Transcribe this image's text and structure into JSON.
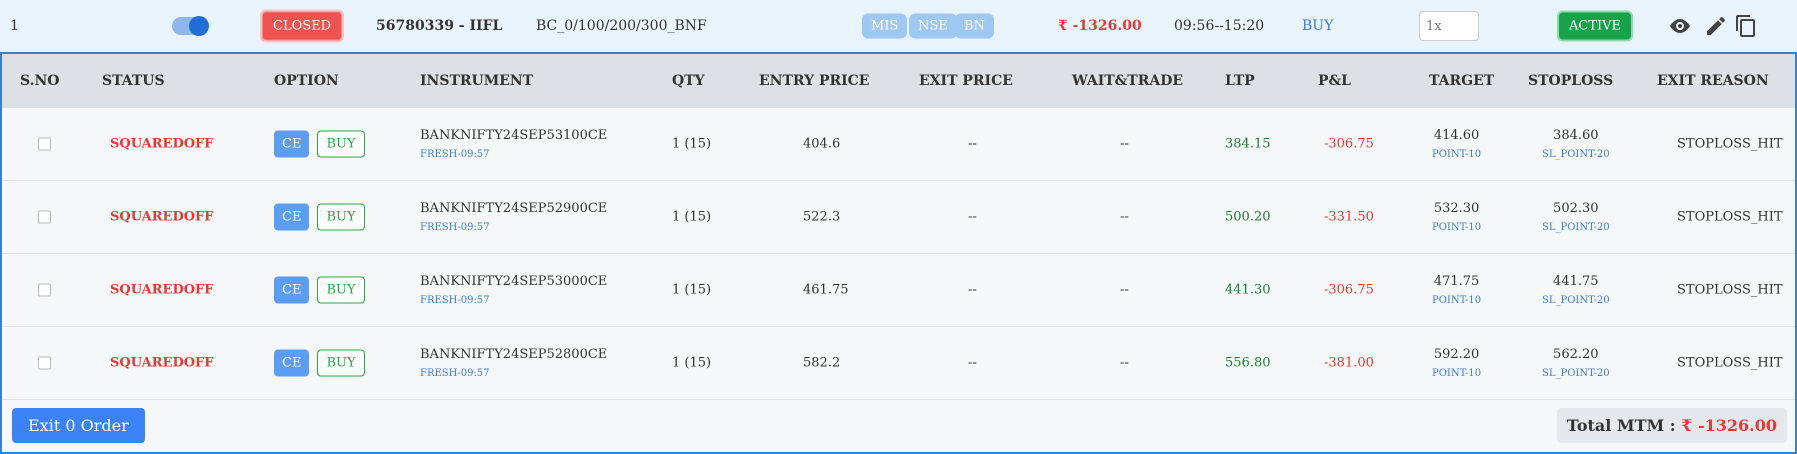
{
  "top_row": {
    "row_number": "1",
    "toggle_state": "on",
    "closed_label": "CLOSED",
    "account": "56780339 - IIFL",
    "strategy": "BC_0/100/200/300_BNF",
    "tags": [
      "MIS",
      "NSE",
      "BN"
    ],
    "pnl": "₹ -1326.00",
    "time_range": "09:56--15:20",
    "side": "BUY",
    "multiplier_placeholder": "1x",
    "active_label": "ACTIVE",
    "icons": [
      "eye-icon",
      "edit-icon",
      "copy-icon"
    ]
  },
  "table": {
    "headers": [
      "S.NO",
      "STATUS",
      "OPTION",
      "INSTRUMENT",
      "QTY",
      "ENTRY PRICE",
      "EXIT PRICE",
      "WAIT&TRADE",
      "LTP",
      "P&L",
      "TARGET",
      "STOPLOSS",
      "EXIT REASON"
    ],
    "rows": [
      {
        "status": "SQUAREDOFF",
        "option_type": "CE",
        "side": "BUY",
        "instrument": "BANKNIFTY24SEP53100CE",
        "instrument_sub": "FRESH-09:57",
        "qty": "1 (15)",
        "entry_price": "404.6",
        "exit_price": "--",
        "wait_trade": "--",
        "ltp": "384.15",
        "pnl": "-306.75",
        "target": "414.60",
        "target_sub": "POINT-10",
        "stoploss": "384.60",
        "stoploss_sub": "SL_POINT-20",
        "exit_reason": "STOPLOSS_HIT"
      },
      {
        "status": "SQUAREDOFF",
        "option_type": "CE",
        "side": "BUY",
        "instrument": "BANKNIFTY24SEP52900CE",
        "instrument_sub": "FRESH-09:57",
        "qty": "1 (15)",
        "entry_price": "522.3",
        "exit_price": "--",
        "wait_trade": "--",
        "ltp": "500.20",
        "pnl": "-331.50",
        "target": "532.30",
        "target_sub": "POINT-10",
        "stoploss": "502.30",
        "stoploss_sub": "SL_POINT-20",
        "exit_reason": "STOPLOSS_HIT"
      },
      {
        "status": "SQUAREDOFF",
        "option_type": "CE",
        "side": "BUY",
        "instrument": "BANKNIFTY24SEP53000CE",
        "instrument_sub": "FRESH-09:57",
        "qty": "1 (15)",
        "entry_price": "461.75",
        "exit_price": "--",
        "wait_trade": "--",
        "ltp": "441.30",
        "pnl": "-306.75",
        "target": "471.75",
        "target_sub": "POINT-10",
        "stoploss": "441.75",
        "stoploss_sub": "SL_POINT-20",
        "exit_reason": "STOPLOSS_HIT"
      },
      {
        "status": "SQUAREDOFF",
        "option_type": "CE",
        "side": "BUY",
        "instrument": "BANKNIFTY24SEP52800CE",
        "instrument_sub": "FRESH-09:57",
        "qty": "1 (15)",
        "entry_price": "582.2",
        "exit_price": "--",
        "wait_trade": "--",
        "ltp": "556.80",
        "pnl": "-381.00",
        "target": "592.20",
        "target_sub": "POINT-10",
        "stoploss": "562.20",
        "stoploss_sub": "SL_POINT-20",
        "exit_reason": "STOPLOSS_HIT"
      }
    ]
  },
  "footer": {
    "exit_order_label": "Exit 0 Order",
    "total_mtm_label": "Total MTM :",
    "total_mtm_value": "₹ -1326.00"
  },
  "colors": {
    "accent_blue": "#3b82f6",
    "closed_red": "#ef5350",
    "active_green": "#17a34a",
    "loss_red": "#e53935",
    "ltp_green": "#1e7e34"
  }
}
